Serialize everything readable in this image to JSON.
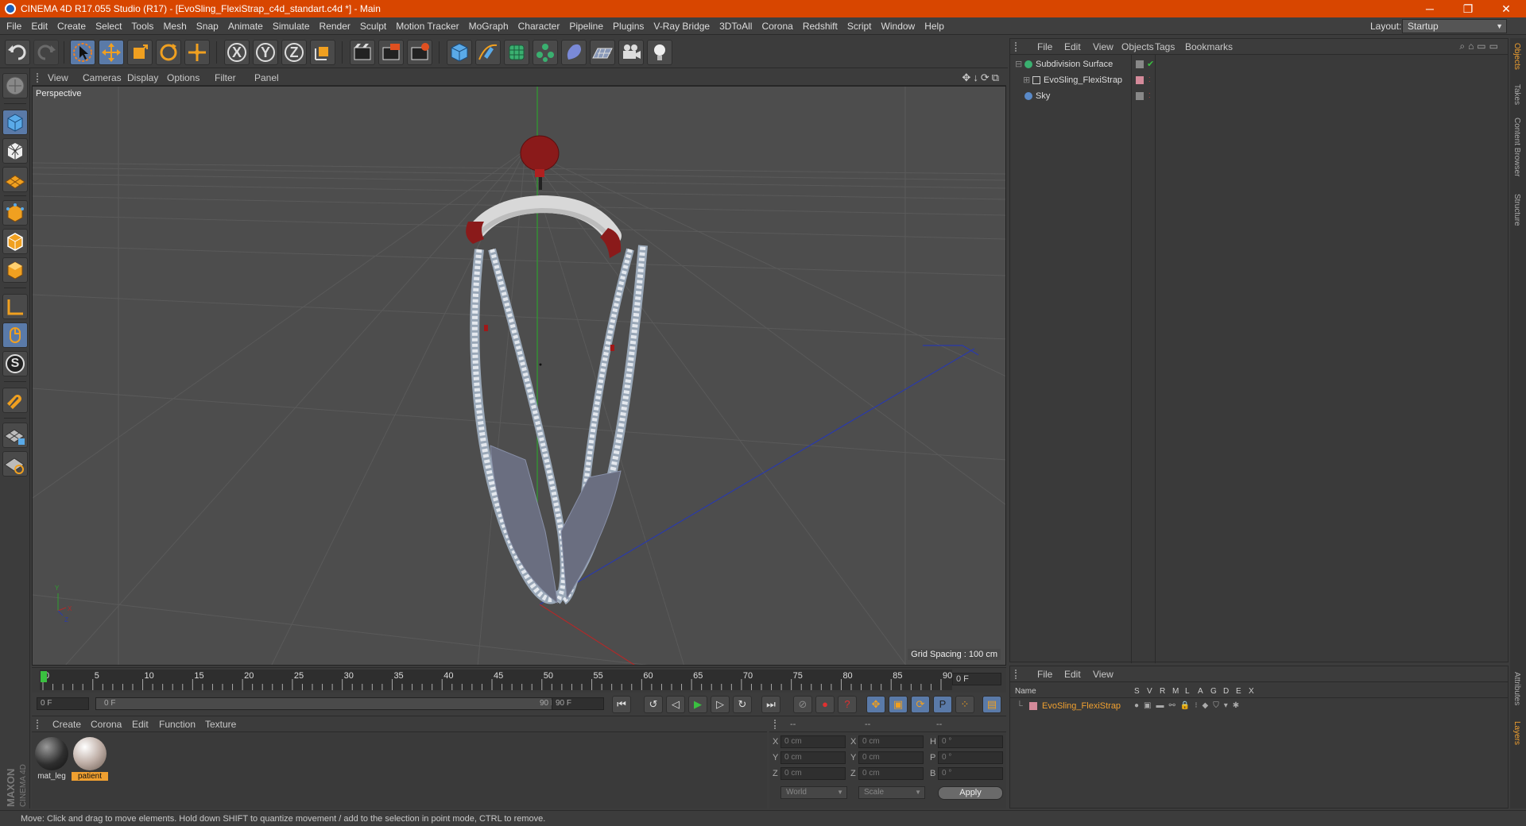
{
  "titlebar": {
    "title": "CINEMA 4D R17.055 Studio (R17) - [EvoSling_FlexiStrap_c4d_standart.c4d *] - Main",
    "minimize": "─",
    "restore": "❐",
    "close": "✕"
  },
  "menubar": {
    "items": [
      "File",
      "Edit",
      "Create",
      "Select",
      "Tools",
      "Mesh",
      "Snap",
      "Animate",
      "Simulate",
      "Render",
      "Sculpt",
      "Motion Tracker",
      "MoGraph",
      "Character",
      "Pipeline",
      "Plugins",
      "V-Ray Bridge",
      "3DToAll",
      "Corona",
      "Redshift",
      "Script",
      "Window",
      "Help"
    ],
    "layout_label": "Layout:",
    "layout_value": "Startup"
  },
  "toolbar": {
    "icons": [
      "undo-icon",
      "redo-icon",
      "select-arrow-icon",
      "move-icon",
      "scale-icon",
      "rotate-icon",
      "live-select-icon",
      "x-axis-icon",
      "y-axis-icon",
      "z-axis-icon",
      "coordinate-system-icon",
      "render-view-icon",
      "render-picture-viewer-icon",
      "edit-render-settings-icon",
      "cube-icon",
      "pen-spline-icon",
      "subdivision-icon",
      "array-icon",
      "deformer-icon",
      "floor-icon",
      "camera-icon",
      "light-icon"
    ],
    "axis_x": "X",
    "axis_y": "Y",
    "axis_z": "Z"
  },
  "viewport": {
    "menu": [
      "View",
      "Cameras",
      "Display",
      "Options",
      "Filter",
      "Panel"
    ],
    "label": "Perspective",
    "grid_spacing": "Grid Spacing : 100 cm",
    "icons": "✥↓⟳⧉"
  },
  "timeline": {
    "ticks": [
      "0",
      "5",
      "10",
      "15",
      "20",
      "25",
      "30",
      "35",
      "40",
      "45",
      "50",
      "55",
      "60",
      "65",
      "70",
      "75",
      "80",
      "85",
      "90"
    ],
    "current_frame": "0 F",
    "start_field": "0 F",
    "range_start": "0 F",
    "range_end": "90 F",
    "end_field": "90 F"
  },
  "material_manager": {
    "menu": [
      "Create",
      "Corona",
      "Edit",
      "Function",
      "Texture"
    ],
    "materials": [
      {
        "name": "mat_leg",
        "selected": false,
        "color": "#2e2e2e"
      },
      {
        "name": "patient",
        "selected": true,
        "color": "#c0b0a8"
      }
    ],
    "brand_top": "MAXON",
    "brand_bottom": "CINEMA 4D"
  },
  "coordinates": {
    "header": [
      "--",
      "--",
      "--"
    ],
    "rows": [
      {
        "a": "X",
        "v1": "0 cm",
        "b": "X",
        "v2": "0 cm",
        "c": "H",
        "v3": "0 °"
      },
      {
        "a": "Y",
        "v1": "0 cm",
        "b": "Y",
        "v2": "0 cm",
        "c": "P",
        "v3": "0 °"
      },
      {
        "a": "Z",
        "v1": "0 cm",
        "b": "Z",
        "v2": "0 cm",
        "c": "B",
        "v3": "0 °"
      }
    ],
    "mode": "World",
    "size_mode": "Scale",
    "apply": "Apply"
  },
  "status": "Move: Click and drag to move elements. Hold down SHIFT to quantize movement / add to the selection in point mode, CTRL to remove.",
  "object_manager": {
    "menu": [
      "File",
      "Edit",
      "View",
      "Objects",
      "Tags",
      "Bookmarks"
    ],
    "objects": [
      {
        "name": "Subdivision Surface",
        "indent": 0
      },
      {
        "name": "EvoSling_FlexiStrap",
        "indent": 1
      },
      {
        "name": "Sky",
        "indent": 0
      }
    ]
  },
  "layer_manager": {
    "menu": [
      "File",
      "Edit",
      "View"
    ],
    "columns": [
      "Name",
      "S",
      "V",
      "R",
      "M",
      "L",
      "A",
      "G",
      "D",
      "E",
      "X"
    ],
    "layers": [
      {
        "name": "EvoSling_FlexiStrap",
        "color": "#d48a9a"
      }
    ]
  },
  "right_tabs": {
    "top": [
      "Objects",
      "Takes",
      "Content Browser",
      "Structure"
    ],
    "bottom": [
      "Attributes",
      "Layers"
    ]
  },
  "colors": {
    "titlebar": "#d84600",
    "accent": "#f0a030",
    "selected_tool": "#5a7aa8"
  }
}
